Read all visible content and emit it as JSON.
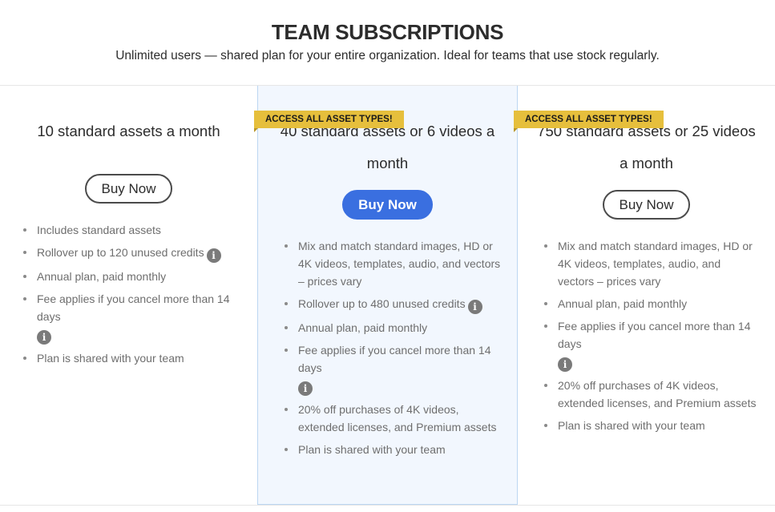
{
  "header": {
    "title": "TEAM SUBSCRIPTIONS",
    "subtitle": "Unlimited users — shared plan for your entire organization. Ideal for teams that use stock regularly."
  },
  "icons": {
    "info": "i"
  },
  "plans": [
    {
      "name": "10 standard assets a month",
      "badge": null,
      "button_label": "Buy Now",
      "button_style": "outline",
      "features": [
        {
          "text": "Includes standard assets",
          "info": false
        },
        {
          "text": "Rollover up to 120 unused credits",
          "info": true
        },
        {
          "text": "Annual plan, paid monthly",
          "info": false
        },
        {
          "text": "Fee applies if you cancel more than 14 days",
          "info": true
        },
        {
          "text": "Plan is shared with your team",
          "info": false
        }
      ]
    },
    {
      "name": "40 standard assets or 6 videos a month",
      "badge": "ACCESS ALL ASSET TYPES!",
      "button_label": "Buy Now",
      "button_style": "primary",
      "highlighted": true,
      "features": [
        {
          "text": "Mix and match standard images, HD or 4K videos, templates, audio, and vectors – prices vary",
          "info": false
        },
        {
          "text": "Rollover up to 480 unused credits",
          "info": true
        },
        {
          "text": "Annual plan, paid monthly",
          "info": false
        },
        {
          "text": "Fee applies if you cancel more than 14 days",
          "info": true
        },
        {
          "text": "20% off purchases of 4K videos, extended licenses, and Premium assets",
          "info": false
        },
        {
          "text": "Plan is shared with your team",
          "info": false
        }
      ]
    },
    {
      "name": "750 standard assets or 25 videos a month",
      "badge": "ACCESS ALL ASSET TYPES!",
      "button_label": "Buy Now",
      "button_style": "outline",
      "features": [
        {
          "text": "Mix and match standard images, HD or 4K videos, templates, audio, and vectors – prices vary",
          "info": false
        },
        {
          "text": "Annual plan, paid monthly",
          "info": false
        },
        {
          "text": "Fee applies if you cancel more than 14 days",
          "info": true
        },
        {
          "text": "20% off purchases of 4K videos, extended licenses, and Premium assets",
          "info": false
        },
        {
          "text": "Plan is shared with your team",
          "info": false
        }
      ]
    }
  ],
  "colors": {
    "primary_button": "#3a6fe0",
    "badge": "#e6bf3c",
    "highlight_bg": "#f2f7fe",
    "highlight_border": "#bcd6f2"
  }
}
